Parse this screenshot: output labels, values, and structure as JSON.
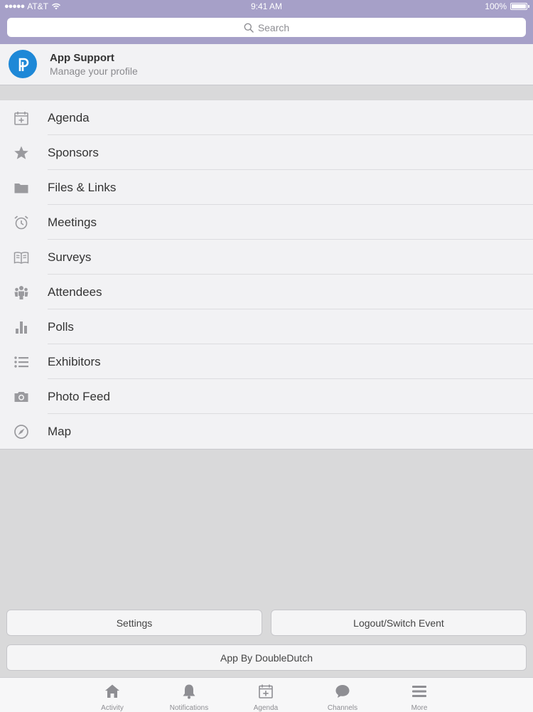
{
  "status": {
    "carrier": "AT&T",
    "time": "9:41 AM",
    "battery": "100%",
    "battery_level": 1.0
  },
  "search": {
    "placeholder": "Search",
    "icon": "search-icon"
  },
  "profile": {
    "name": "App Support",
    "subtitle": "Manage your profile"
  },
  "menu": {
    "items": [
      {
        "label": "Agenda",
        "icon": "calendar-icon"
      },
      {
        "label": "Sponsors",
        "icon": "star-icon"
      },
      {
        "label": "Files & Links",
        "icon": "folder-icon"
      },
      {
        "label": "Meetings",
        "icon": "alarm-clock-icon"
      },
      {
        "label": "Surveys",
        "icon": "open-book-icon"
      },
      {
        "label": "Attendees",
        "icon": "people-icon"
      },
      {
        "label": "Polls",
        "icon": "bar-chart-icon"
      },
      {
        "label": "Exhibitors",
        "icon": "list-icon"
      },
      {
        "label": "Photo Feed",
        "icon": "camera-icon"
      },
      {
        "label": "Map",
        "icon": "compass-icon"
      }
    ]
  },
  "buttons": {
    "settings": "Settings",
    "logout": "Logout/Switch Event",
    "about": "App By DoubleDutch"
  },
  "tabbar": {
    "tabs": [
      {
        "label": "Activity",
        "icon": "home-icon"
      },
      {
        "label": "Notifications",
        "icon": "bell-icon"
      },
      {
        "label": "Agenda",
        "icon": "calendar-icon"
      },
      {
        "label": "Channels",
        "icon": "chat-bubble-icon"
      },
      {
        "label": "More",
        "icon": "menu-icon"
      }
    ]
  },
  "colors": {
    "header": "#a6a0c8",
    "avatar": "#1e88d7",
    "icon_gray": "#9a9a9e"
  }
}
